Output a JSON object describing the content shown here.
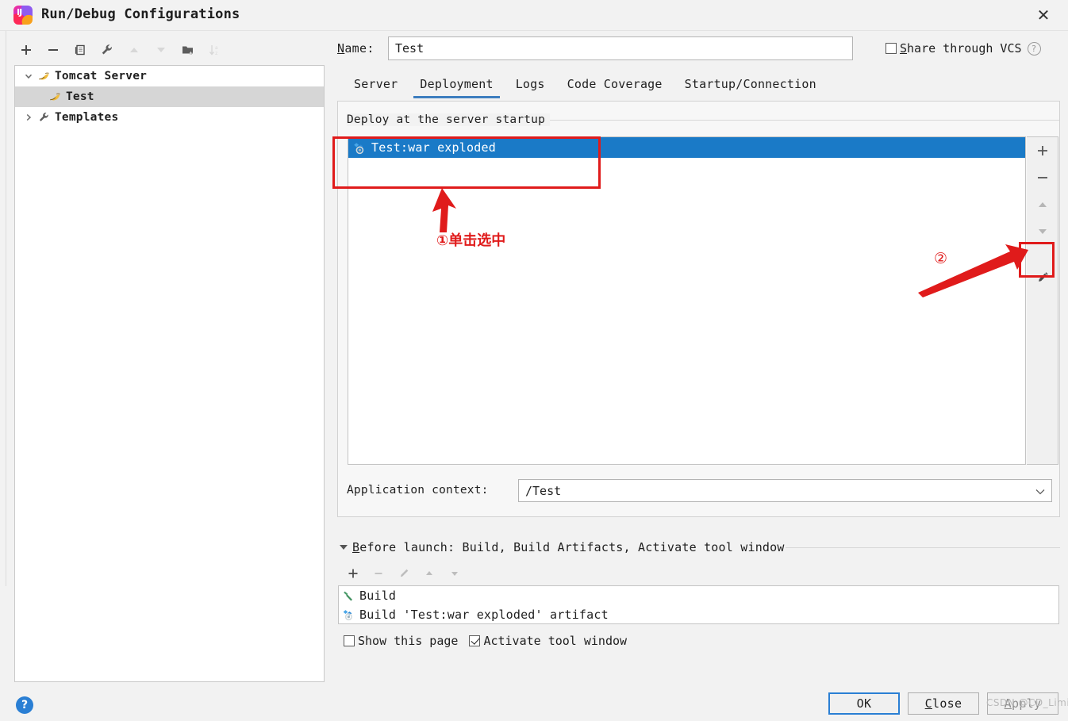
{
  "window": {
    "title": "Run/Debug Configurations",
    "logo_icon": "intellij-idea-logo-icon",
    "close_icon": "close-icon"
  },
  "left_toolbar": {
    "buttons": [
      {
        "name": "add-configuration-button",
        "icon": "plus-icon",
        "label": "+",
        "disabled": false
      },
      {
        "name": "remove-configuration-button",
        "icon": "minus-icon",
        "label": "−",
        "disabled": false
      },
      {
        "name": "copy-configuration-button",
        "icon": "copy-icon",
        "label": "copy",
        "disabled": false
      },
      {
        "name": "edit-templates-button",
        "icon": "wrench-icon",
        "label": "wrench",
        "disabled": false
      },
      {
        "name": "move-up-button",
        "icon": "arrow-up-icon",
        "label": "▲",
        "disabled": true
      },
      {
        "name": "move-down-button",
        "icon": "arrow-down-icon",
        "label": "▼",
        "disabled": true
      },
      {
        "name": "new-folder-button",
        "icon": "folder-add-icon",
        "label": "folder",
        "disabled": false
      },
      {
        "name": "sort-configurations-button",
        "icon": "sort-alpha-icon",
        "label": "sort",
        "disabled": true
      }
    ]
  },
  "tree": {
    "items": [
      {
        "label": "Tomcat Server",
        "icon": "tomcat-icon",
        "expander": "⌄",
        "expanded": true,
        "level": 0,
        "selected": false
      },
      {
        "label": "Test",
        "icon": "tomcat-icon",
        "expander": "",
        "expanded": false,
        "level": 1,
        "selected": true
      },
      {
        "label": "Templates",
        "icon": "wrench-icon",
        "expander": "›",
        "expanded": false,
        "level": 0,
        "selected": false
      }
    ]
  },
  "help": {
    "icon": "help-question-icon",
    "label": "?"
  },
  "name_field": {
    "label": "Name:",
    "label_mnemonic": "N",
    "label_rest": "ame:",
    "value": "Test",
    "placeholder": "Name"
  },
  "share": {
    "label_mnemonic": "S",
    "label_rest": "hare through VCS",
    "full_label": "Share through VCS",
    "checked": false,
    "help_icon": "help-question-icon",
    "help_label": "?"
  },
  "tabs": [
    {
      "label": "Server",
      "active": false
    },
    {
      "label": "Deployment",
      "active": true
    },
    {
      "label": "Logs",
      "active": false
    },
    {
      "label": "Code Coverage",
      "active": false
    },
    {
      "label": "Startup/Connection",
      "active": false
    }
  ],
  "deployment": {
    "group_title": "Deploy at the server startup",
    "items": [
      {
        "label": "Test:war exploded",
        "icon": "artifact-icon",
        "selected": true
      }
    ],
    "side_buttons": [
      {
        "name": "add-artifact-button",
        "icon": "plus-icon",
        "label": "+",
        "dim": false
      },
      {
        "name": "remove-artifact-button",
        "icon": "minus-icon",
        "label": "−",
        "dim": false
      },
      {
        "name": "move-artifact-up-button",
        "icon": "arrow-up-icon",
        "label": "▲",
        "dim": true
      },
      {
        "name": "move-artifact-down-button",
        "icon": "arrow-down-icon",
        "label": "▼",
        "dim": true
      },
      {
        "name": "edit-artifact-button",
        "icon": "pencil-edit-icon",
        "label": "pencil",
        "dim": false
      }
    ],
    "application_context": {
      "label": "Application context:",
      "value": "/Test",
      "dropdown_icon": "chevron-down-icon"
    }
  },
  "before_launch": {
    "toggle_icon": "triangle-down-icon",
    "title_mnemonic": "B",
    "title_rest": "efore launch: Build, Build Artifacts, Activate tool window",
    "title_full": "Before launch: Build, Build Artifacts, Activate tool window",
    "toolbar": [
      {
        "name": "add-task-button",
        "icon": "plus-icon",
        "label": "+",
        "dim": false
      },
      {
        "name": "remove-task-button",
        "icon": "minus-icon",
        "label": "−",
        "dim": true
      },
      {
        "name": "edit-task-button",
        "icon": "pencil-edit-icon",
        "label": "✐",
        "dim": true
      },
      {
        "name": "move-task-up-button",
        "icon": "arrow-up-icon",
        "label": "▲",
        "dim": true
      },
      {
        "name": "move-task-down-button",
        "icon": "arrow-down-icon",
        "label": "▼",
        "dim": true
      }
    ],
    "tasks": [
      {
        "label": "Build",
        "icon": "build-hammer-icon"
      },
      {
        "label": "Build 'Test:war exploded' artifact",
        "icon": "artifact-icon"
      }
    ],
    "checkboxes": [
      {
        "name": "show-this-page-checkbox",
        "label": "Show this page",
        "checked": false
      },
      {
        "name": "activate-tool-window-checkbox",
        "label": "Activate tool window",
        "checked": true
      }
    ]
  },
  "footer": {
    "buttons": [
      {
        "name": "ok-button",
        "label": "OK",
        "mnemonic": "",
        "rest": "OK",
        "style": "default",
        "disabled": false
      },
      {
        "name": "close-button",
        "label": "Close",
        "mnemonic": "C",
        "rest": "lose",
        "style": "normal",
        "disabled": false
      },
      {
        "name": "apply-button",
        "label": "Apply",
        "mnemonic": "A",
        "rest": "pply",
        "style": "normal",
        "disabled": true
      }
    ]
  },
  "annotations": {
    "step1_text": "①单击选中",
    "step2_mark": "②",
    "color": "#e01b1b"
  },
  "watermark": {
    "text": "CSDN @CD_Limi"
  }
}
